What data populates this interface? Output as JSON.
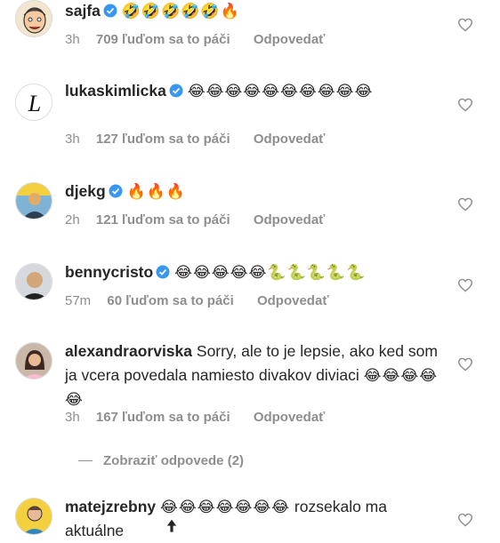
{
  "comments": [
    {
      "username": "sajfa",
      "verified": true,
      "text": "",
      "emoji": "🤣🤣🤣🤣🤣🔥",
      "time": "3h",
      "likes": "709 ľuďom sa to páči",
      "reply": "Odpovedať",
      "avatar_icon": "cartoon-face-avatar"
    },
    {
      "username": "lukaskimlicka",
      "verified": true,
      "text": "",
      "emoji": "😂😂😂😂😂😂😂😂😂😂",
      "time": "3h",
      "likes": "127 ľuďom sa to páči",
      "reply": "Odpovedať",
      "avatar_icon": "letter-L-logo-avatar"
    },
    {
      "username": "djekg",
      "verified": true,
      "text": "",
      "emoji": "🔥🔥🔥",
      "time": "2h",
      "likes": "121 ľuďom sa to páči",
      "reply": "Odpovedať",
      "avatar_icon": "person-photo-avatar"
    },
    {
      "username": "bennycristo",
      "verified": true,
      "text": "",
      "emoji": "😂😂😂😂😂🐍🐍🐍🐍🐍",
      "time": "57m",
      "likes": "60 ľuďom sa to páči",
      "reply": "Odpovedať",
      "avatar_icon": "person-photo-avatar"
    },
    {
      "username": "alexandraorviska",
      "verified": false,
      "text": "Sorry, ale to je lepsie, ako ked som ja vcera povedala namiesto divakov diviaci",
      "emoji": "😂😂😂😂😂",
      "time": "3h",
      "likes": "167 ľuďom sa to páči",
      "reply": "Odpovedať",
      "avatar_icon": "person-photo-avatar"
    },
    {
      "username": "matejzrebny",
      "verified": false,
      "text": "",
      "emoji": "😂😂😂😂😂😂😂",
      "text_after": "rozsekalo ma aktuálne",
      "time": "",
      "likes": "",
      "reply": "",
      "avatar_icon": "cartoon-person-avatar"
    }
  ],
  "view_replies": "Zobraziť odpovede (2)",
  "colors": {
    "text": "#262626",
    "meta": "#8e8e8e",
    "verified": "#3897f0",
    "heart": "#8e8e8e"
  }
}
